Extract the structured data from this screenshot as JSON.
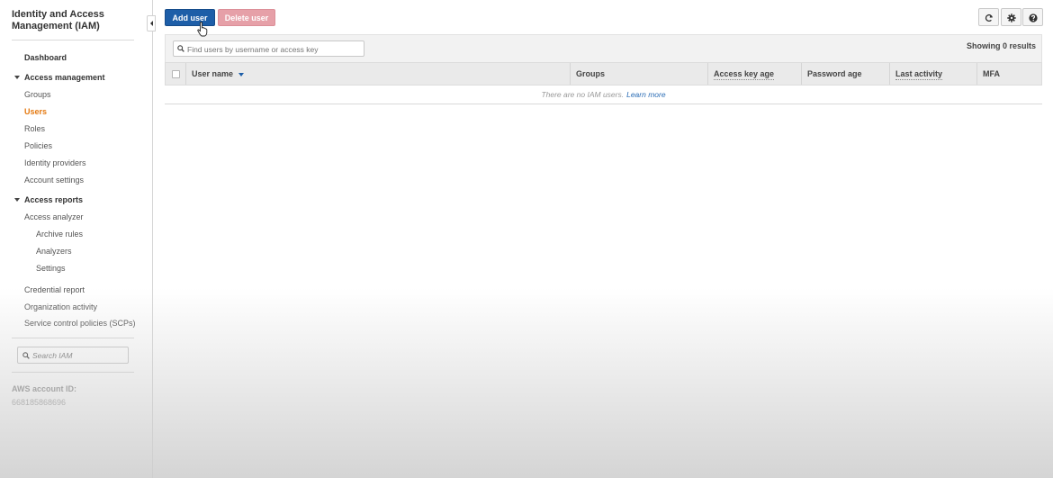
{
  "sidebar": {
    "title": "Identity and Access Management (IAM)",
    "dashboard": "Dashboard",
    "access_management": {
      "label": "Access management",
      "items": [
        "Groups",
        "Users",
        "Roles",
        "Policies",
        "Identity providers",
        "Account settings"
      ],
      "active": "Users"
    },
    "access_reports": {
      "label": "Access reports",
      "analyzer": "Access analyzer",
      "analyzer_items": [
        "Archive rules",
        "Analyzers",
        "Settings"
      ],
      "items": [
        "Credential report",
        "Organization activity",
        "Service control policies (SCPs)"
      ]
    },
    "search_placeholder": "Search IAM",
    "account_label": "AWS account ID:",
    "account_id": "668185868696"
  },
  "toolbar": {
    "add_user": "Add user",
    "delete_user": "Delete user",
    "icons": [
      "refresh-icon",
      "gear-icon",
      "help-icon"
    ]
  },
  "table": {
    "filter_placeholder": "Find users by username or access key",
    "results": "Showing 0 results",
    "columns": [
      "User name",
      "Groups",
      "Access key age",
      "Password age",
      "Last activity",
      "MFA"
    ],
    "empty_message": "There are no IAM users.",
    "learn_more": "Learn more"
  },
  "colors": {
    "primary": "#1d5ea8",
    "danger_disabled": "#e6a0a8",
    "active_nav": "#e47911",
    "link": "#2a6cb5"
  }
}
